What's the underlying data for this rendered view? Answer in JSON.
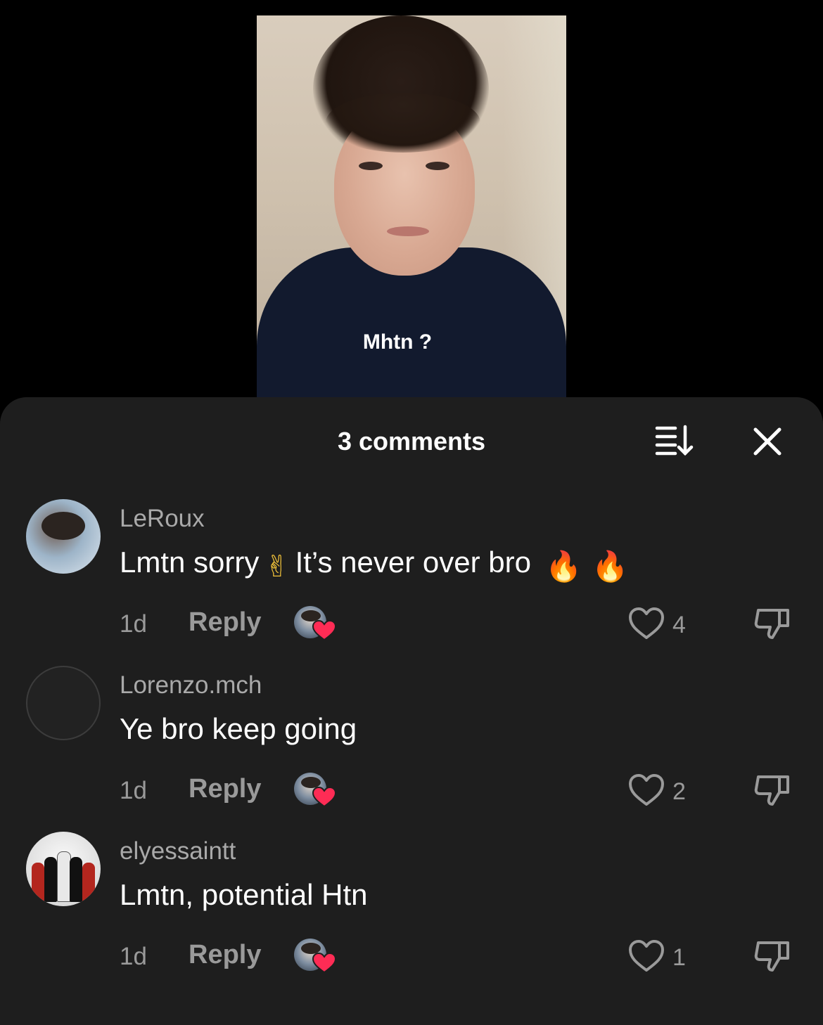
{
  "video": {
    "caption": "Mhtn ?"
  },
  "sheet": {
    "title": "3 comments",
    "icons": {
      "sort": "sort-icon",
      "close": "close-icon"
    }
  },
  "comments": [
    {
      "username": "LeRoux",
      "text_before": "Lmtn sorry",
      "emoji_mid": "✌",
      "text_after": "It’s never over bro",
      "emoji_end": "🔥🔥",
      "time": "1d",
      "reply": "Reply",
      "likes": "4"
    },
    {
      "username": "Lorenzo.mch",
      "text": "Ye bro keep going",
      "time": "1d",
      "reply": "Reply",
      "likes": "2"
    },
    {
      "username": "elyessaintt",
      "text": "Lmtn, potential Htn",
      "time": "1d",
      "reply": "Reply",
      "likes": "1"
    }
  ],
  "colors": {
    "sheet_bg": "#1e1e1e",
    "liked_heart": "#fe2c55",
    "muted_text": "#9a9a9a"
  }
}
